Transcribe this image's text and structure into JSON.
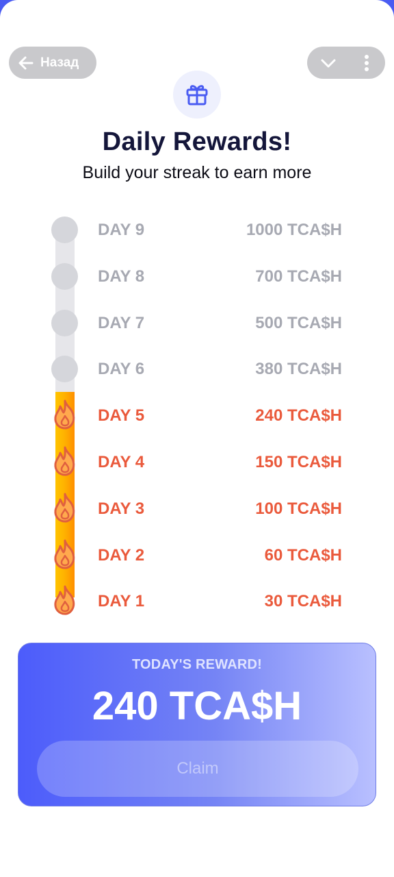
{
  "header": {
    "back_label": "Назад",
    "back_icon": "arrow-left-icon",
    "collapse_icon": "chevron-down-icon",
    "more_icon": "more-vertical-icon",
    "gift_icon": "gift-icon"
  },
  "title": "Daily Rewards!",
  "subtitle": "Build your streak to earn more",
  "streak": {
    "completed_days": 5,
    "days": [
      {
        "label": "DAY 9",
        "amount": "1000 TCA$H",
        "done": false
      },
      {
        "label": "DAY 8",
        "amount": "700 TCA$H",
        "done": false
      },
      {
        "label": "DAY 7",
        "amount": "500 TCA$H",
        "done": false
      },
      {
        "label": "DAY 6",
        "amount": "380 TCA$H",
        "done": false
      },
      {
        "label": "DAY 5",
        "amount": "240 TCA$H",
        "done": true
      },
      {
        "label": "DAY 4",
        "amount": "150 TCA$H",
        "done": true
      },
      {
        "label": "DAY 3",
        "amount": "100 TCA$H",
        "done": true
      },
      {
        "label": "DAY 2",
        "amount": "60 TCA$H",
        "done": true
      },
      {
        "label": "DAY 1",
        "amount": "30 TCA$H",
        "done": true
      }
    ]
  },
  "reward": {
    "label": "TODAY'S REWARD!",
    "value": "240 TCA$H",
    "claim_label": "Claim"
  },
  "colors": {
    "accent": "#4a5cf2",
    "active": "#ea5a3c",
    "inactive": "#a7a9b2",
    "title": "#14163a"
  }
}
